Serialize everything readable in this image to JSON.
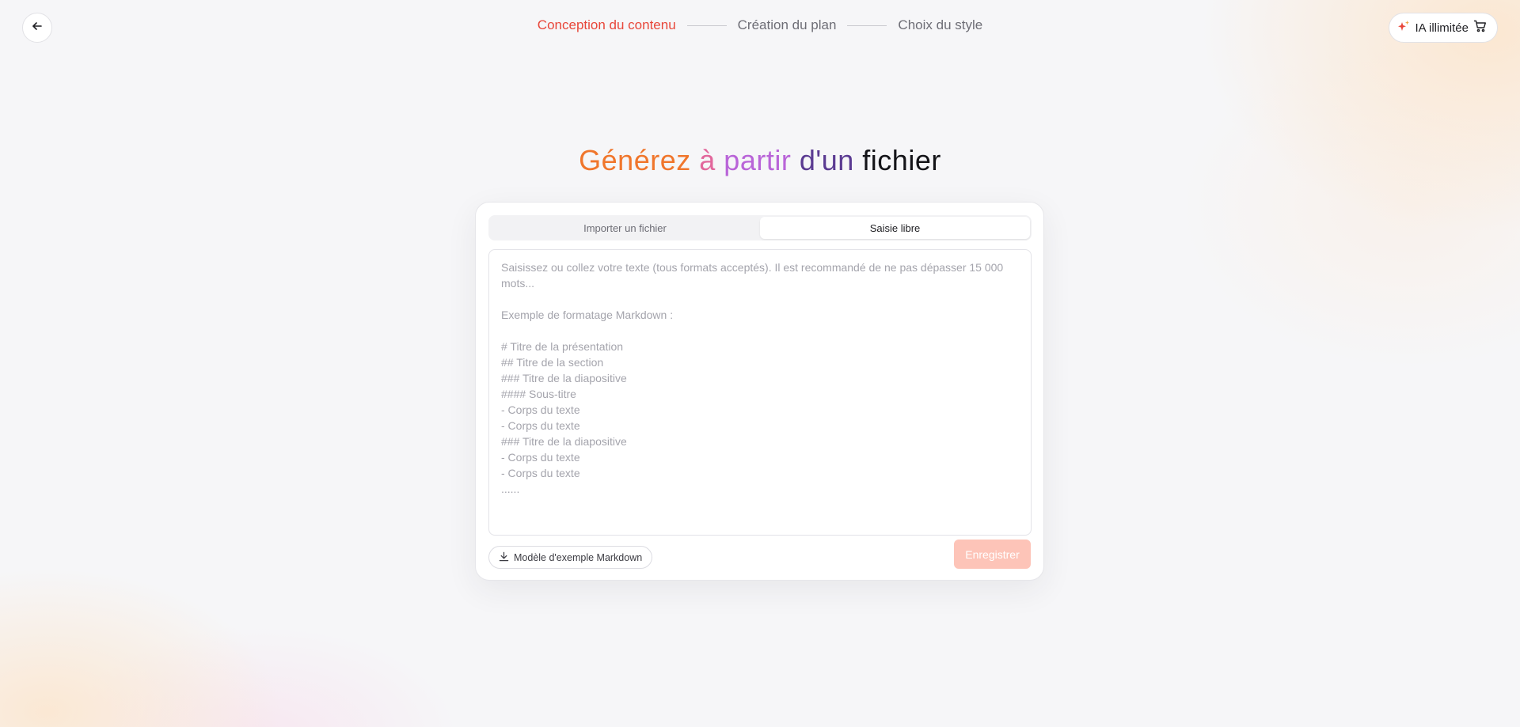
{
  "header": {
    "back_icon": "arrow-left-icon",
    "steps": [
      {
        "label": "Conception du contenu",
        "active": true
      },
      {
        "label": "Création du plan",
        "active": false
      },
      {
        "label": "Choix du style",
        "active": false
      }
    ],
    "ia_button": {
      "label": "IA illimitée",
      "sparkle_icon": "sparkle-icon",
      "cart_icon": "cart-icon"
    }
  },
  "headline": {
    "parts": [
      "Générez",
      "à",
      "partir",
      "d'un",
      "fichier"
    ]
  },
  "card": {
    "tabs": [
      {
        "label": "Importer un fichier",
        "active": false
      },
      {
        "label": "Saisie libre",
        "active": true
      }
    ],
    "textarea": {
      "value": "",
      "placeholder": "Saisissez ou collez votre texte (tous formats acceptés). Il est recommandé de ne pas dépasser 15 000 mots...\n\nExemple de formatage Markdown :\n\n# Titre de la présentation\n## Titre de la section\n### Titre de la diapositive\n#### Sous-titre\n- Corps du texte\n- Corps du texte\n### Titre de la diapositive\n- Corps du texte\n- Corps du texte\n......"
    },
    "markdown_button": {
      "label": "Modèle d'exemple Markdown",
      "icon": "download-icon"
    },
    "save_button": {
      "label": "Enregistrer",
      "disabled": true
    }
  },
  "colors": {
    "accent": "#e8473a",
    "save_disabled": "#fdc4b8",
    "headline": [
      "#f0762c",
      "#e2679c",
      "#b964d8",
      "#5b3b92",
      "#141418"
    ]
  }
}
